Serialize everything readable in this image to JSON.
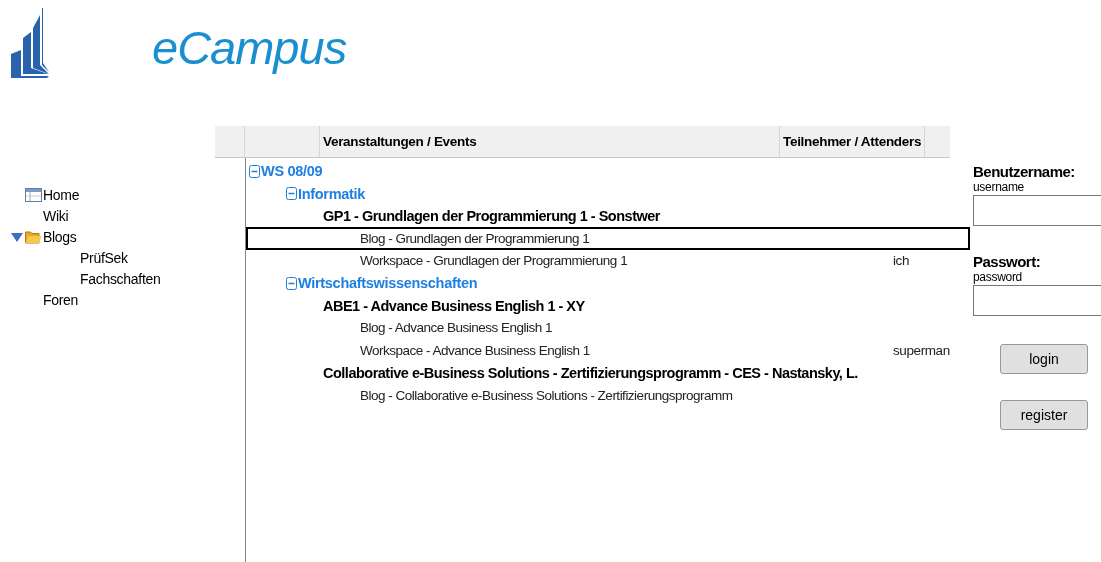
{
  "logo": {
    "title": "eCampus"
  },
  "sidebar": {
    "items": [
      {
        "label": "Home",
        "kind": "page"
      },
      {
        "label": "Wiki",
        "kind": "link"
      },
      {
        "label": "Blogs",
        "kind": "folder",
        "expanded": true,
        "children": [
          {
            "label": "PrüfSek",
            "kind": "link"
          },
          {
            "label": "Fachschaften",
            "kind": "link"
          }
        ]
      },
      {
        "label": "Foren",
        "kind": "link"
      }
    ]
  },
  "table": {
    "columns": [
      "Veranstaltungen / Events",
      "Teilnehmer / Attenders"
    ],
    "rows": [
      {
        "label": "WS 08/09",
        "kind": "group",
        "expanded": true,
        "selected": false,
        "children": [
          {
            "label": "Informatik",
            "kind": "group",
            "expanded": true,
            "selected": false,
            "children": [
              {
                "label": "GP1 - Grundlagen der Programmierung 1 - Sonstwer",
                "kind": "course",
                "selected": false,
                "children": [
                  {
                    "label": "Blog - Grundlagen der Programmierung 1",
                    "kind": "item",
                    "selected": true
                  },
                  {
                    "label": "Workspace - Grundlagen der Programmierung 1",
                    "kind": "item",
                    "attender": "ich",
                    "selected": false
                  }
                ]
              }
            ]
          },
          {
            "label": "Wirtschaftswissenschaften",
            "kind": "group",
            "expanded": true,
            "selected": false,
            "children": [
              {
                "label": "ABE1 - Advance Business English 1 - XY",
                "kind": "course",
                "selected": false,
                "children": [
                  {
                    "label": "Blog - Advance Business English 1",
                    "kind": "item",
                    "selected": false
                  },
                  {
                    "label": "Workspace - Advance Business English 1",
                    "kind": "item",
                    "attender": "superman",
                    "selected": false
                  }
                ]
              },
              {
                "label": "Collaborative e-Business Solutions - Zertifizierungsprogramm - CES - Nastansky, L.",
                "kind": "course",
                "selected": false,
                "children": [
                  {
                    "label": "Blog - Collaborative e-Business Solutions - Zertifizierungsprogramm",
                    "kind": "item",
                    "selected": false
                  }
                ]
              }
            ]
          }
        ]
      }
    ]
  },
  "login": {
    "username_label": "Benutzername:",
    "username_hint": "username",
    "password_label": "Passwort:",
    "password_hint": "password",
    "buttons": [
      "login",
      "register"
    ]
  }
}
